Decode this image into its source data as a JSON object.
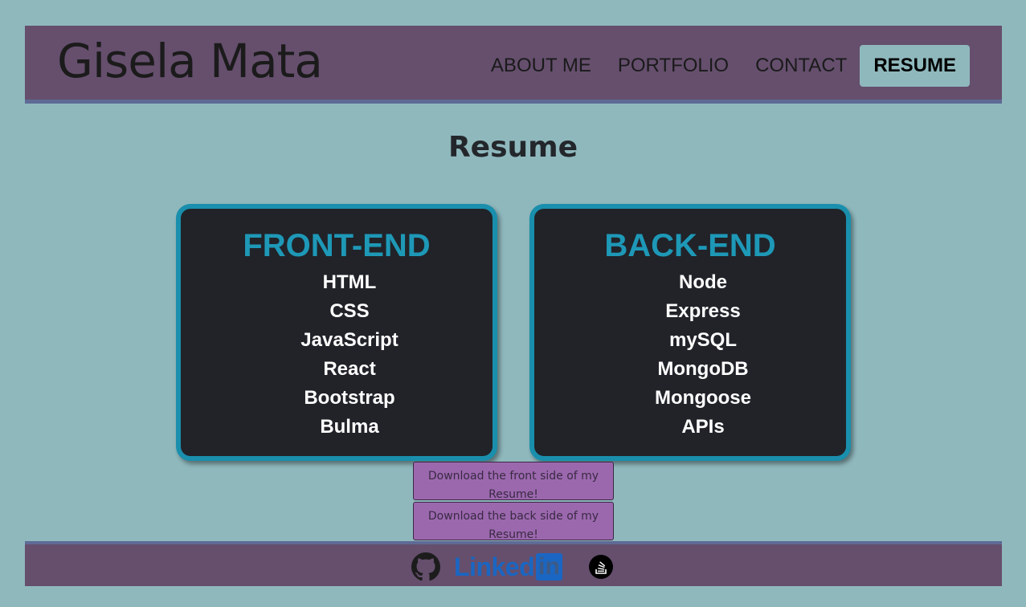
{
  "header": {
    "brand": "Gisela Mata",
    "nav": [
      {
        "label": "ABOUT ME"
      },
      {
        "label": "PORTFOLIO"
      },
      {
        "label": "CONTACT"
      },
      {
        "label": "RESUME",
        "active": true
      }
    ]
  },
  "main": {
    "title": "Resume",
    "cards": [
      {
        "title": "FRONT-END",
        "items": [
          "HTML",
          "CSS",
          "JavaScript",
          "React",
          "Bootstrap",
          "Bulma"
        ]
      },
      {
        "title": "BACK-END",
        "items": [
          "Node",
          "Express",
          "mySQL",
          "MongoDB",
          "Mongoose",
          "APIs"
        ]
      }
    ],
    "buttons": {
      "front": "Download the front side of my Resume!",
      "back": "Download the back side of my Resume!"
    }
  },
  "footer": {
    "icons": [
      "github-icon",
      "linkedin-icon",
      "stackoverflow-icon"
    ],
    "linkedin_word": "Linked",
    "linkedin_box": "in"
  },
  "colors": {
    "background": "#8fb8bd",
    "header": "#654f6d",
    "card_bg": "#212329",
    "card_accent": "#1a8fad",
    "button": "#9b68ae"
  }
}
